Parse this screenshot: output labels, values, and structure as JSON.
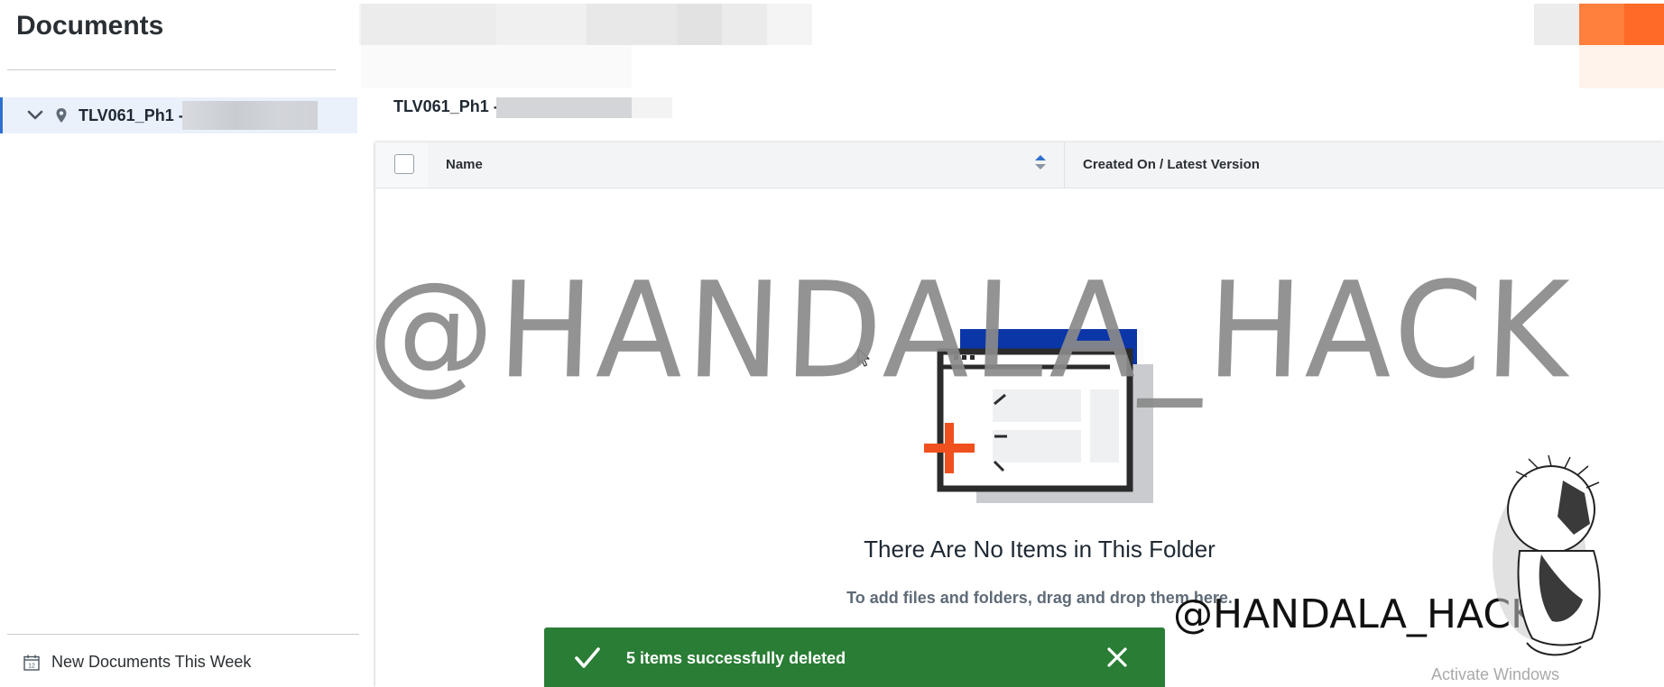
{
  "app": {
    "title": "Documents"
  },
  "sidebar": {
    "tree": [
      {
        "label": "TLV061_Ph1 -",
        "expanded": true,
        "selected": true,
        "icon": "location-pin-icon"
      }
    ],
    "footer_link": {
      "label": "New Documents This Week",
      "icon": "calendar-icon"
    }
  },
  "breadcrumb": {
    "current": "TLV061_Ph1 -"
  },
  "table": {
    "columns": [
      {
        "label": "Name",
        "sortable": true
      },
      {
        "label": "Created On / Latest Version"
      }
    ],
    "rows": []
  },
  "empty_state": {
    "title": "There Are No Items in This Folder",
    "subtitle": "To add files and folders, drag and drop them here."
  },
  "toast": {
    "message": "5 items successfully deleted",
    "status": "success",
    "color": "#2a7d35"
  },
  "overlay": {
    "watermark_large": "@HANDALA_HACK",
    "watermark_small": "@HANDALA_HACK",
    "activation_notice": "Activate Windows"
  },
  "colors": {
    "accent": "#2f6fce",
    "illustration_blue": "#0b36a8",
    "illustration_orange": "#f0501e",
    "toolbar_orange": "#ff7a3a"
  }
}
